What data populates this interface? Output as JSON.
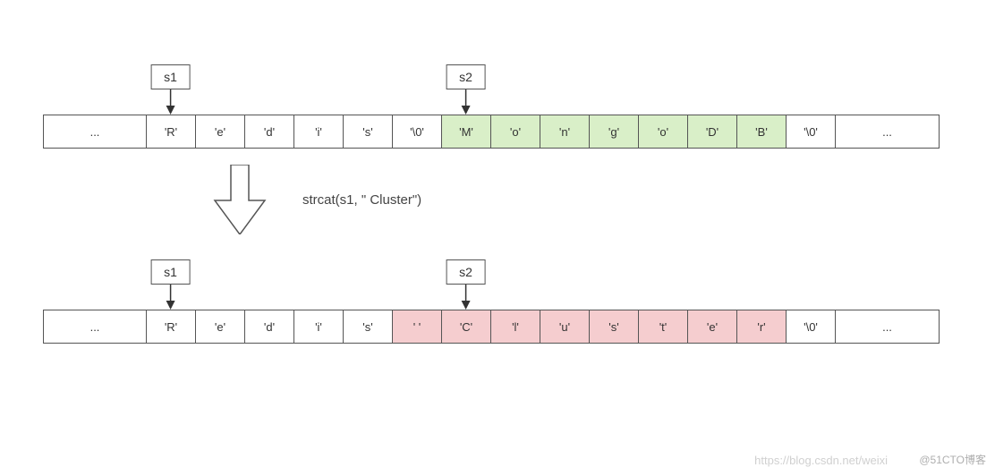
{
  "diagram": {
    "before": {
      "pointers": [
        {
          "name": "ptr-s1",
          "label": "s1",
          "targetIndex": 1
        },
        {
          "name": "ptr-s2",
          "label": "s2",
          "targetIndex": 7
        }
      ],
      "cells": [
        {
          "text": "...",
          "class": "wide"
        },
        {
          "text": "'R'",
          "class": "narrow"
        },
        {
          "text": "'e'",
          "class": "narrow"
        },
        {
          "text": "'d'",
          "class": "narrow"
        },
        {
          "text": "'i'",
          "class": "narrow"
        },
        {
          "text": "'s'",
          "class": "narrow"
        },
        {
          "text": "'\\0'",
          "class": "narrow"
        },
        {
          "text": "'M'",
          "class": "narrow green"
        },
        {
          "text": "'o'",
          "class": "narrow green"
        },
        {
          "text": "'n'",
          "class": "narrow green"
        },
        {
          "text": "'g'",
          "class": "narrow green"
        },
        {
          "text": "'o'",
          "class": "narrow green"
        },
        {
          "text": "'D'",
          "class": "narrow green"
        },
        {
          "text": "'B'",
          "class": "narrow green"
        },
        {
          "text": "'\\0'",
          "class": "narrow"
        },
        {
          "text": "...",
          "class": "wide"
        }
      ]
    },
    "operation": "strcat(s1, \" Cluster\")",
    "after": {
      "pointers": [
        {
          "name": "ptr-s1",
          "label": "s1",
          "targetIndex": 1
        },
        {
          "name": "ptr-s2",
          "label": "s2",
          "targetIndex": 7
        }
      ],
      "cells": [
        {
          "text": "...",
          "class": "wide"
        },
        {
          "text": "'R'",
          "class": "narrow"
        },
        {
          "text": "'e'",
          "class": "narrow"
        },
        {
          "text": "'d'",
          "class": "narrow"
        },
        {
          "text": "'i'",
          "class": "narrow"
        },
        {
          "text": "'s'",
          "class": "narrow"
        },
        {
          "text": "' '",
          "class": "narrow pink"
        },
        {
          "text": "'C'",
          "class": "narrow pink"
        },
        {
          "text": "'l'",
          "class": "narrow pink"
        },
        {
          "text": "'u'",
          "class": "narrow pink"
        },
        {
          "text": "'s'",
          "class": "narrow pink"
        },
        {
          "text": "'t'",
          "class": "narrow pink"
        },
        {
          "text": "'e'",
          "class": "narrow pink"
        },
        {
          "text": "'r'",
          "class": "narrow pink"
        },
        {
          "text": "'\\0'",
          "class": "narrow"
        },
        {
          "text": "...",
          "class": "wide"
        }
      ]
    }
  },
  "watermarks": {
    "csdn": "https://blog.csdn.net/weixi",
    "cto": "@51CTO博客"
  },
  "layout": {
    "wide": 115,
    "narrow": 55
  }
}
